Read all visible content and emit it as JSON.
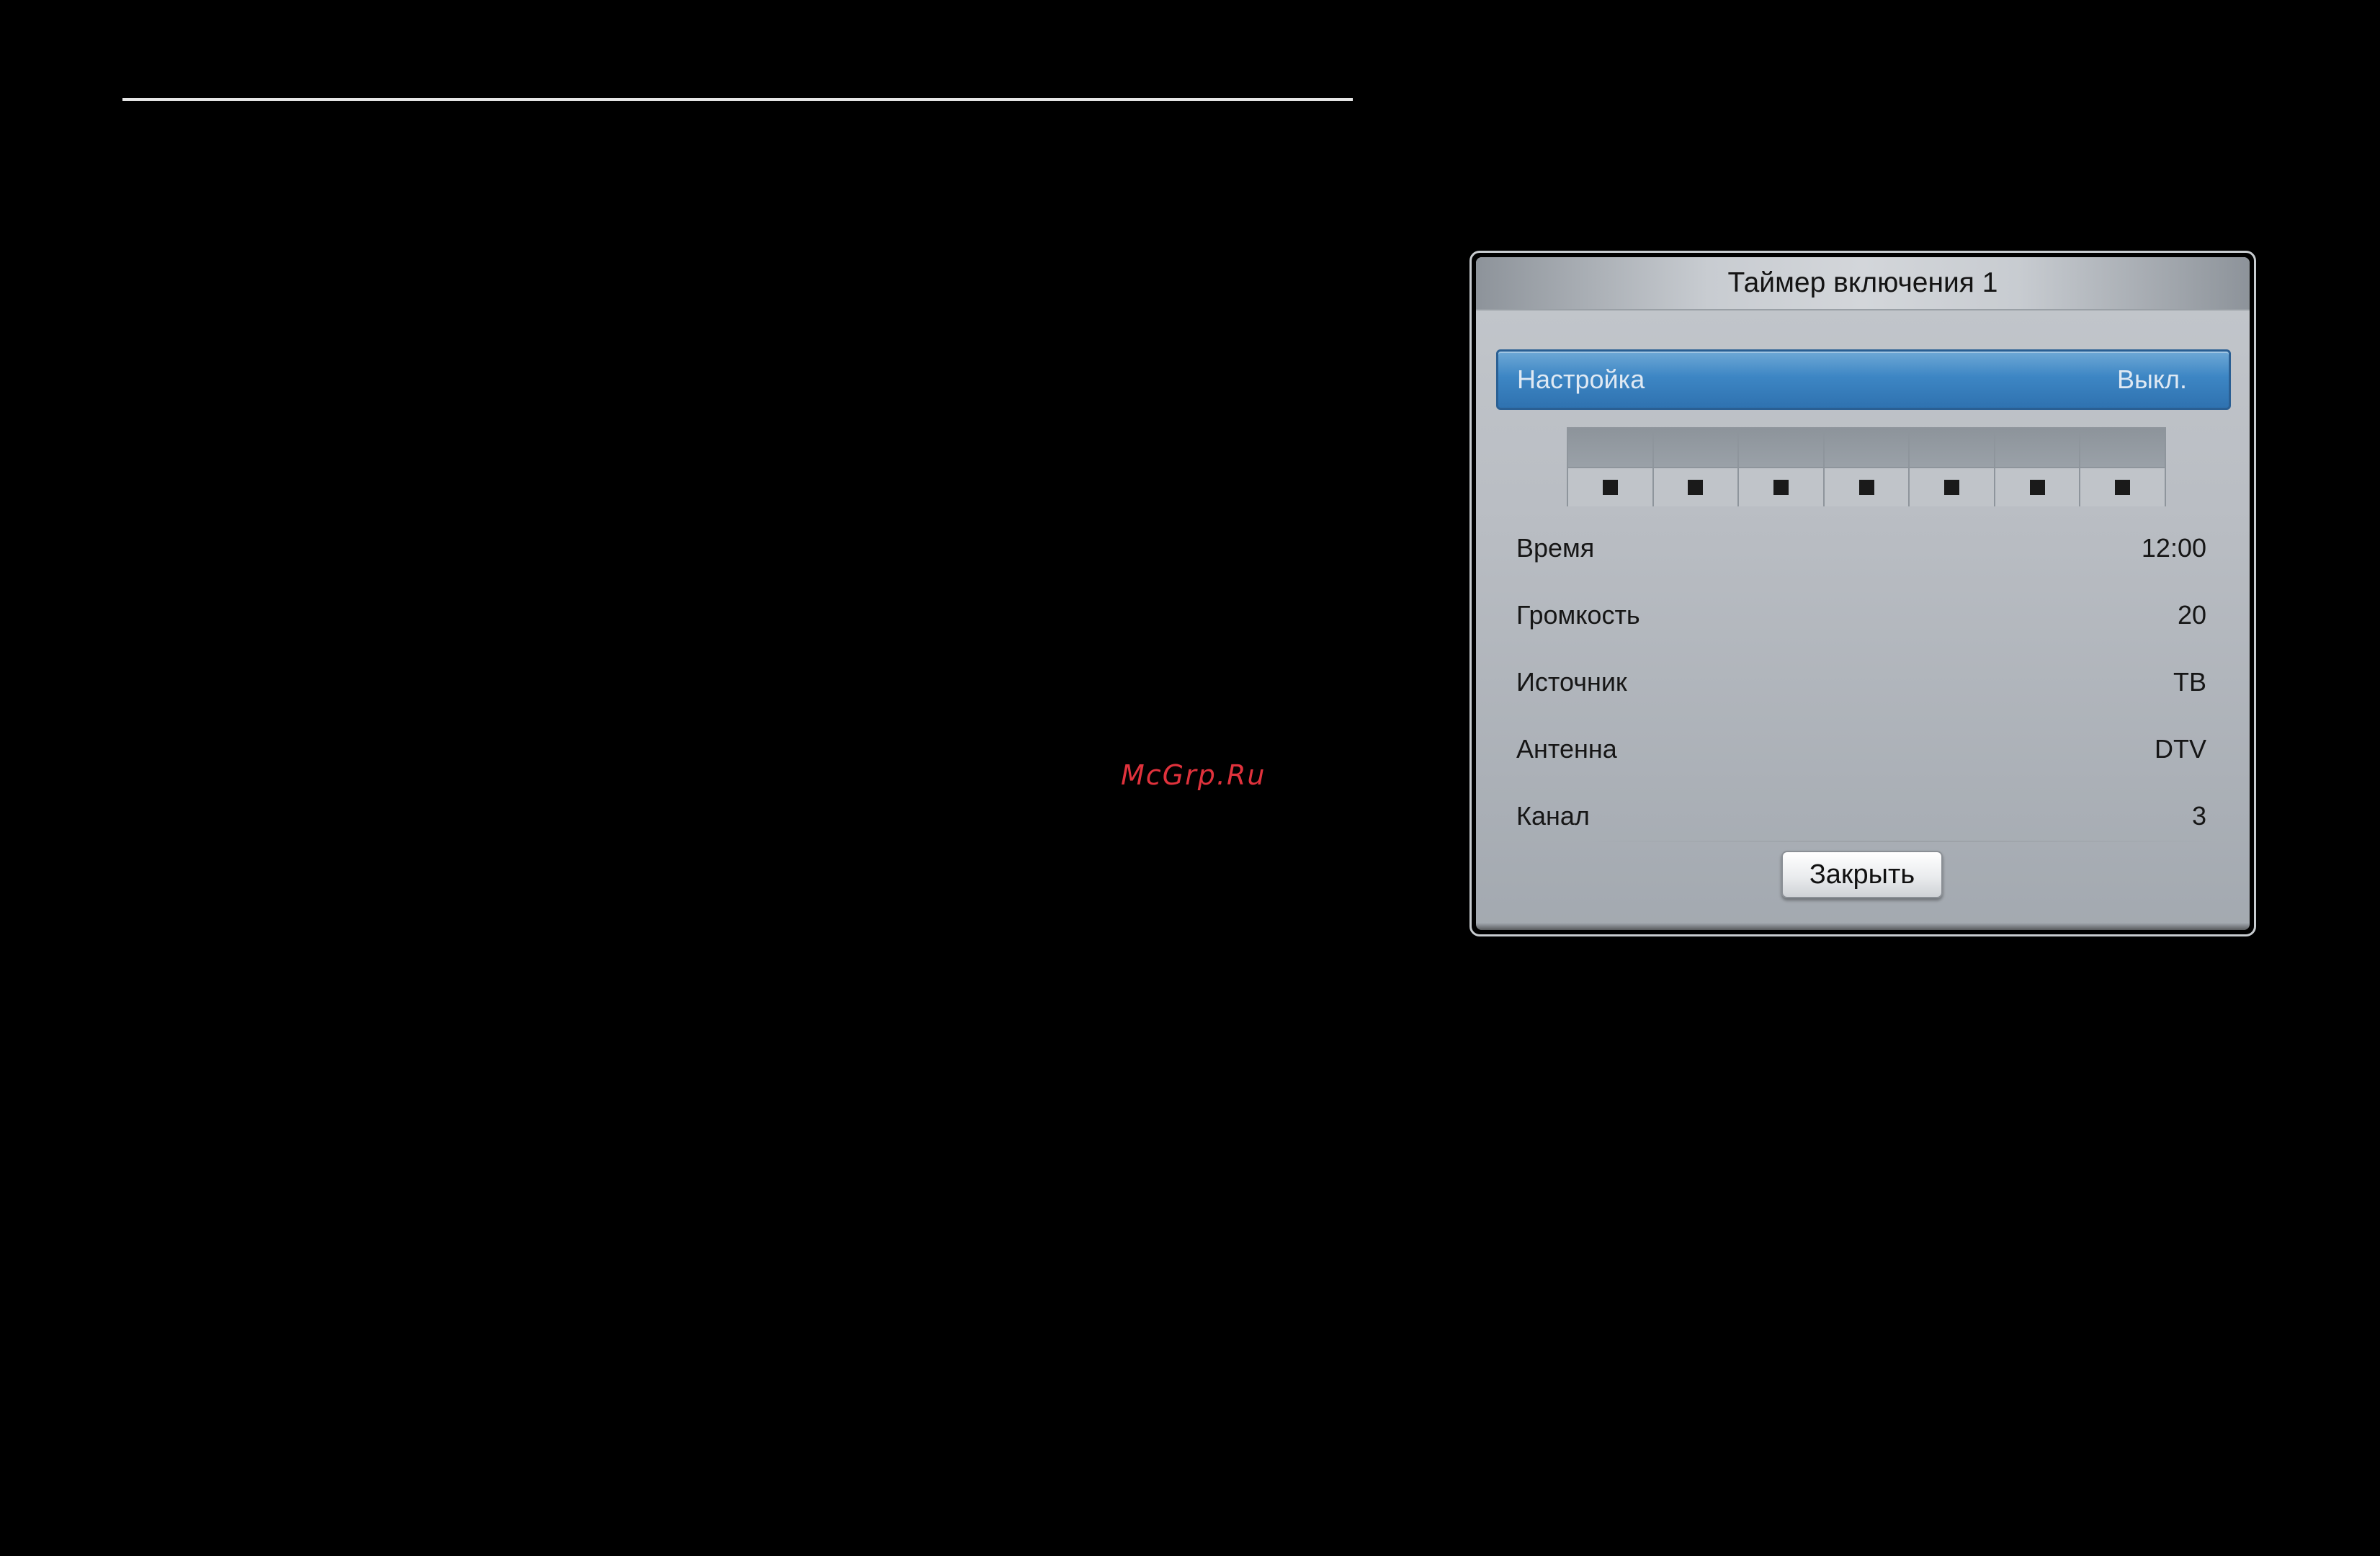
{
  "watermark": "McGrp.Ru",
  "dialog": {
    "title": "Таймер включения 1",
    "setup": {
      "label": "Настройка",
      "value": "Выкл."
    },
    "days": {
      "labels": [
        "",
        "",
        "",
        "",
        "",
        "",
        ""
      ],
      "checked": [
        true,
        true,
        true,
        true,
        true,
        true,
        true
      ]
    },
    "rows": [
      {
        "label": "Время",
        "value": "12:00"
      },
      {
        "label": "Громкость",
        "value": "20"
      },
      {
        "label": "Источник",
        "value": "ТВ"
      },
      {
        "label": "Антенна",
        "value": "DTV"
      },
      {
        "label": "Канал",
        "value": "3"
      }
    ],
    "close_label": "Закрыть"
  },
  "colors": {
    "highlight": "#3d86c4",
    "watermark": "#e0323c"
  }
}
